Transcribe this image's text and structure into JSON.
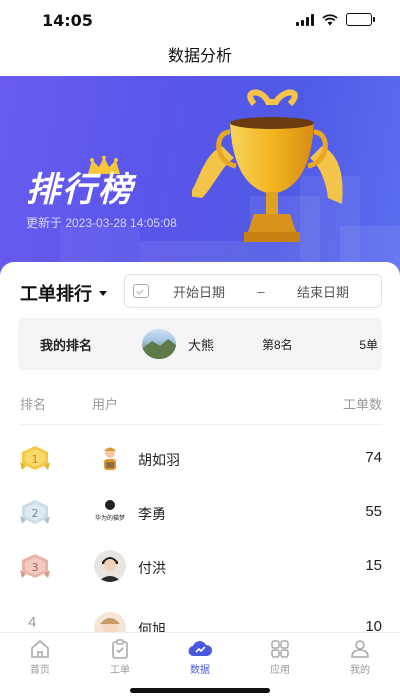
{
  "status_bar": {
    "time": "14:05"
  },
  "nav": {
    "title": "数据分析"
  },
  "banner": {
    "title": "排行榜",
    "update_text": "更新于 2023-03-28 14:05:08"
  },
  "filter": {
    "type_label": "工单排行",
    "start_date": "开始日期",
    "separator": "–",
    "end_date": "结束日期"
  },
  "my_rank": {
    "label": "我的排名",
    "name": "大熊",
    "position": "第8名",
    "count": "5单"
  },
  "list_header": {
    "rank": "排名",
    "user": "用户",
    "count": "工单数"
  },
  "rows": [
    {
      "rank": "1",
      "name": "胡如羽",
      "count": "74"
    },
    {
      "rank": "2",
      "name": "李勇",
      "count": "55"
    },
    {
      "rank": "3",
      "name": "付洪",
      "count": "15"
    },
    {
      "rank": "4",
      "name": "何旭",
      "count": "10"
    }
  ],
  "avatar_text": {
    "row2": "华为的猫梦"
  },
  "tabs": [
    {
      "label": "首页",
      "icon": "home-icon"
    },
    {
      "label": "工单",
      "icon": "clipboard-icon"
    },
    {
      "label": "数据",
      "icon": "cloud-icon"
    },
    {
      "label": "应用",
      "icon": "grid-icon"
    },
    {
      "label": "我的",
      "icon": "person-icon"
    }
  ],
  "colors": {
    "accent": "#4a58e0",
    "banner": "#5a55ea",
    "gold": "#f2b51f"
  }
}
